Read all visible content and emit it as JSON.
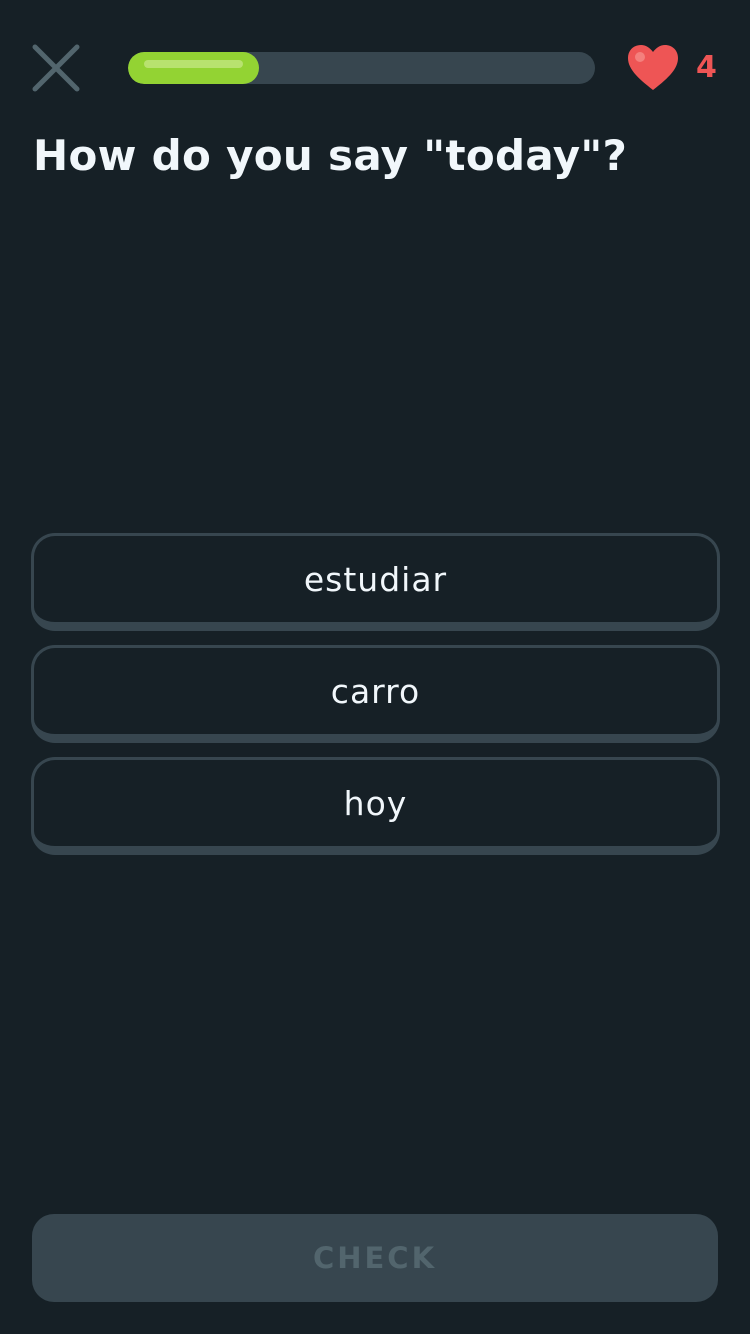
{
  "header": {
    "close_icon": "close-x-icon",
    "progress_fraction": 0.28,
    "hearts_icon": "heart-icon",
    "hearts_count": "4"
  },
  "question": {
    "text": "How do you say \"today\"?"
  },
  "options": [
    {
      "label": "estudiar"
    },
    {
      "label": "carro"
    },
    {
      "label": "hoy"
    }
  ],
  "footer": {
    "check_label": "CHECK",
    "check_enabled": false
  },
  "colors": {
    "background": "#162026",
    "progress_track": "#37464f",
    "progress_fill": "#93d333",
    "heart": "#ee5555",
    "option_border": "#37464f",
    "check_disabled_bg": "#37464f",
    "check_disabled_text": "#52656d"
  }
}
